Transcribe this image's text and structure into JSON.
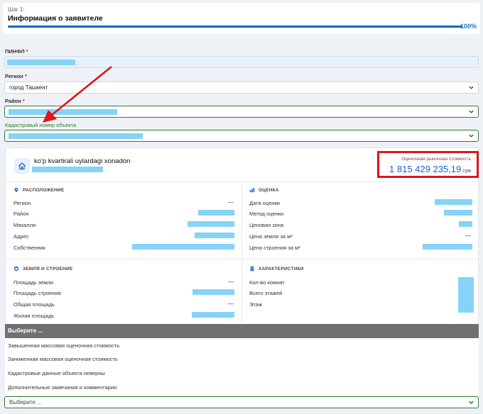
{
  "step": {
    "label": "Шаг 1:",
    "title": "Информация о заявителе",
    "progress_percent": 100,
    "progress_text": "100%"
  },
  "form": {
    "pinfl": {
      "label": "ПИНФЛ",
      "required_mark": "*"
    },
    "region": {
      "label": "Регион",
      "required_mark": "*",
      "value": "город Ташкент"
    },
    "district": {
      "label": "Район",
      "required_mark": "*"
    },
    "cadastre": {
      "label": "Кадастровый номер объекта"
    }
  },
  "object": {
    "title": "ko'p kvartirali uylardagi xonadon",
    "price_label": "Оценочная рыночная стоимость",
    "price_value": "1 815 429 235,19",
    "price_currency": "сум"
  },
  "sections": {
    "location": {
      "title": "Расположение",
      "rows": [
        "Регион",
        "Район",
        "Махалля",
        "Адрес",
        "Собственник"
      ],
      "dash": "—"
    },
    "valuation": {
      "title": "Оценка",
      "rows": [
        "Дата оценки",
        "Метод оценки",
        "Ценовая зона",
        "Цена земли за м²",
        "Цена строения за м²"
      ],
      "dash": "—"
    },
    "land": {
      "title": "Земля и строение",
      "rows": [
        "Площадь земли",
        "Площадь строения",
        "Общая площадь",
        "Жилая площадь"
      ],
      "dash1": "—",
      "dash2": "—"
    },
    "characteristics": {
      "title": "Характеристики",
      "rows": [
        "Кол-во комнат",
        "Всего этажей",
        "Этаж"
      ]
    }
  },
  "dropdown": {
    "header": "Выберите ...",
    "options": [
      "Завышенная массовая оценочная стоимость",
      "Заниженная массовая оценочная стоимость",
      "Кадастровые данные объекта неверны",
      "Дополнительные замечания и комментарии"
    ],
    "placeholder": "Выберите ..."
  },
  "colors": {
    "accent": "#1e63c7",
    "highlight": "#e0151b",
    "valid": "#2e7d32",
    "mask": "#86d3f7"
  }
}
